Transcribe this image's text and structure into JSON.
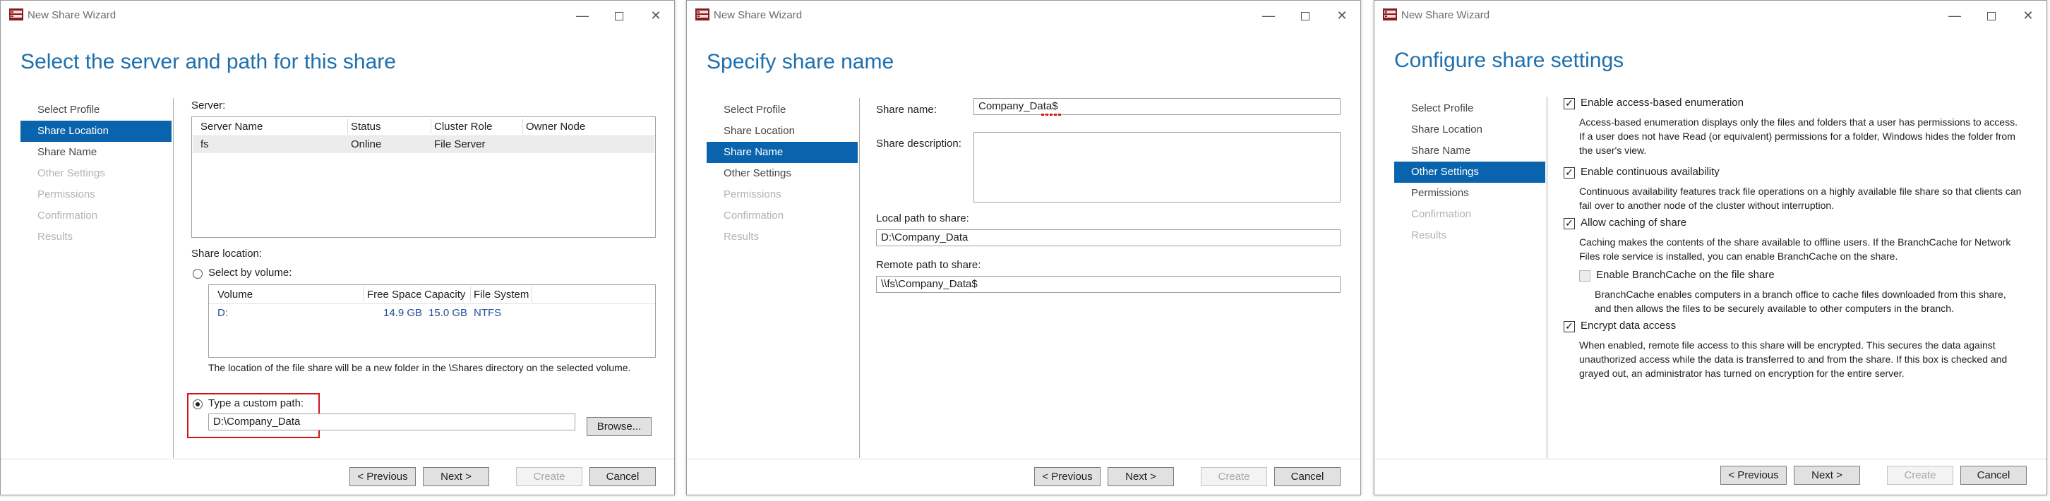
{
  "app_title": "New Share Wizard",
  "buttons": {
    "previous": "< Previous",
    "next": "Next >",
    "create": "Create",
    "cancel": "Cancel"
  },
  "nav": [
    "Select Profile",
    "Share Location",
    "Share Name",
    "Other Settings",
    "Permissions",
    "Confirmation",
    "Results"
  ],
  "windows": [
    {
      "heading": "Select the server and path for this share",
      "active_nav": "Share Location",
      "server_label": "Server:",
      "server_table": {
        "columns": [
          "Server Name",
          "Status",
          "Cluster Role",
          "Owner Node"
        ],
        "rows": [
          [
            "fs",
            "Online",
            "File Server",
            ""
          ]
        ]
      },
      "share_location_label": "Share location:",
      "select_by_volume_label": "Select by volume:",
      "volume_table": {
        "columns": [
          "Volume",
          "Free Space",
          "Capacity",
          "File System"
        ],
        "rows": [
          [
            "D:",
            "14.9 GB",
            "15.0 GB",
            "NTFS"
          ]
        ]
      },
      "location_note": "The location of the file share will be a new folder in the \\Shares directory on the selected volume.",
      "custom_path_label": "Type a custom path:",
      "custom_path_value": "D:\\Company_Data",
      "browse_label": "Browse..."
    },
    {
      "heading": "Specify share name",
      "active_nav": "Share Name",
      "share_name_label": "Share name:",
      "share_name_value": "Company_Data$",
      "share_description_label": "Share description:",
      "share_description_value": "",
      "local_path_label": "Local path to share:",
      "local_path_value": "D:\\Company_Data",
      "remote_path_label": "Remote path to share:",
      "remote_path_value": "\\\\fs\\Company_Data$"
    },
    {
      "heading": "Configure share settings",
      "active_nav": "Other Settings",
      "settings": [
        {
          "label": "Enable access-based enumeration",
          "checked": true,
          "enabled": true,
          "description": "Access-based enumeration displays only the files and folders that a user has permissions to access. If a user does not have Read (or equivalent) permissions for a folder, Windows hides the folder from the user's view."
        },
        {
          "label": "Enable continuous availability",
          "checked": true,
          "enabled": true,
          "description": "Continuous availability features track file operations on a highly available file share so that clients can fail over to another node of the cluster without interruption."
        },
        {
          "label": "Allow caching of share",
          "checked": true,
          "enabled": true,
          "description": "Caching makes the contents of the share available to offline users. If the BranchCache for Network Files role service is installed, you can enable BranchCache on the share."
        },
        {
          "label": "Enable BranchCache on the file share",
          "checked": false,
          "enabled": false,
          "description": "BranchCache enables computers in a branch office to cache files downloaded from this share, and then allows the files to be securely available to other computers in the branch."
        },
        {
          "label": "Encrypt data access",
          "checked": true,
          "enabled": true,
          "description": "When enabled, remote file access to this share will be encrypted. This secures the data against unauthorized access while the data is transferred to and from the share. If this box is checked and grayed out, an administrator has turned on encryption for the entire server."
        }
      ]
    }
  ],
  "colors": {
    "accent": "#0a64ad",
    "heading": "#1e6fad",
    "highlight": "#d4141b"
  }
}
